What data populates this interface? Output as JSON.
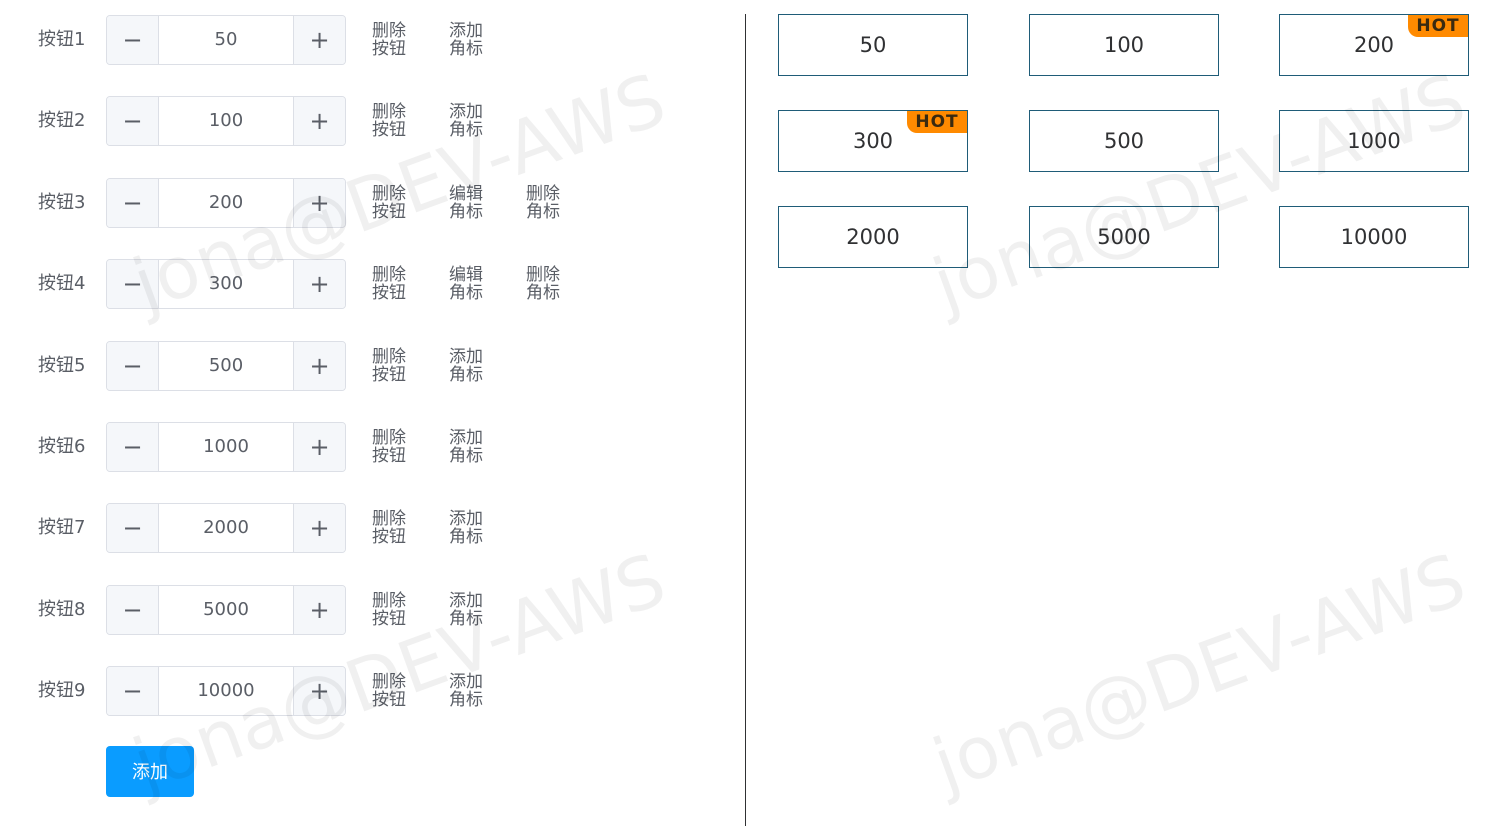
{
  "rows": [
    {
      "label": "按钮1",
      "value": "50",
      "actions": [
        "删除按钮",
        "添加角标"
      ]
    },
    {
      "label": "按钮2",
      "value": "100",
      "actions": [
        "删除按钮",
        "添加角标"
      ]
    },
    {
      "label": "按钮3",
      "value": "200",
      "actions": [
        "删除按钮",
        "编辑角标",
        "删除角标"
      ]
    },
    {
      "label": "按钮4",
      "value": "300",
      "actions": [
        "删除按钮",
        "编辑角标",
        "删除角标"
      ]
    },
    {
      "label": "按钮5",
      "value": "500",
      "actions": [
        "删除按钮",
        "添加角标"
      ]
    },
    {
      "label": "按钮6",
      "value": "1000",
      "actions": [
        "删除按钮",
        "添加角标"
      ]
    },
    {
      "label": "按钮7",
      "value": "2000",
      "actions": [
        "删除按钮",
        "添加角标"
      ]
    },
    {
      "label": "按钮8",
      "value": "5000",
      "actions": [
        "删除按钮",
        "添加角标"
      ]
    },
    {
      "label": "按钮9",
      "value": "10000",
      "actions": [
        "删除按钮",
        "添加角标"
      ]
    }
  ],
  "stepper": {
    "minus_symbol": "−",
    "plus_symbol": "+"
  },
  "add_button_label": "添加",
  "preview": [
    {
      "value": "50",
      "badge": ""
    },
    {
      "value": "100",
      "badge": ""
    },
    {
      "value": "200",
      "badge": "HOT"
    },
    {
      "value": "300",
      "badge": "HOT"
    },
    {
      "value": "500",
      "badge": ""
    },
    {
      "value": "1000",
      "badge": ""
    },
    {
      "value": "2000",
      "badge": ""
    },
    {
      "value": "5000",
      "badge": ""
    },
    {
      "value": "10000",
      "badge": ""
    }
  ],
  "watermark_text": "jona@DEV-AWS",
  "colors": {
    "accent": "#0a9cff",
    "badge": "#ff8a00",
    "preview_border": "#1f5c78"
  }
}
